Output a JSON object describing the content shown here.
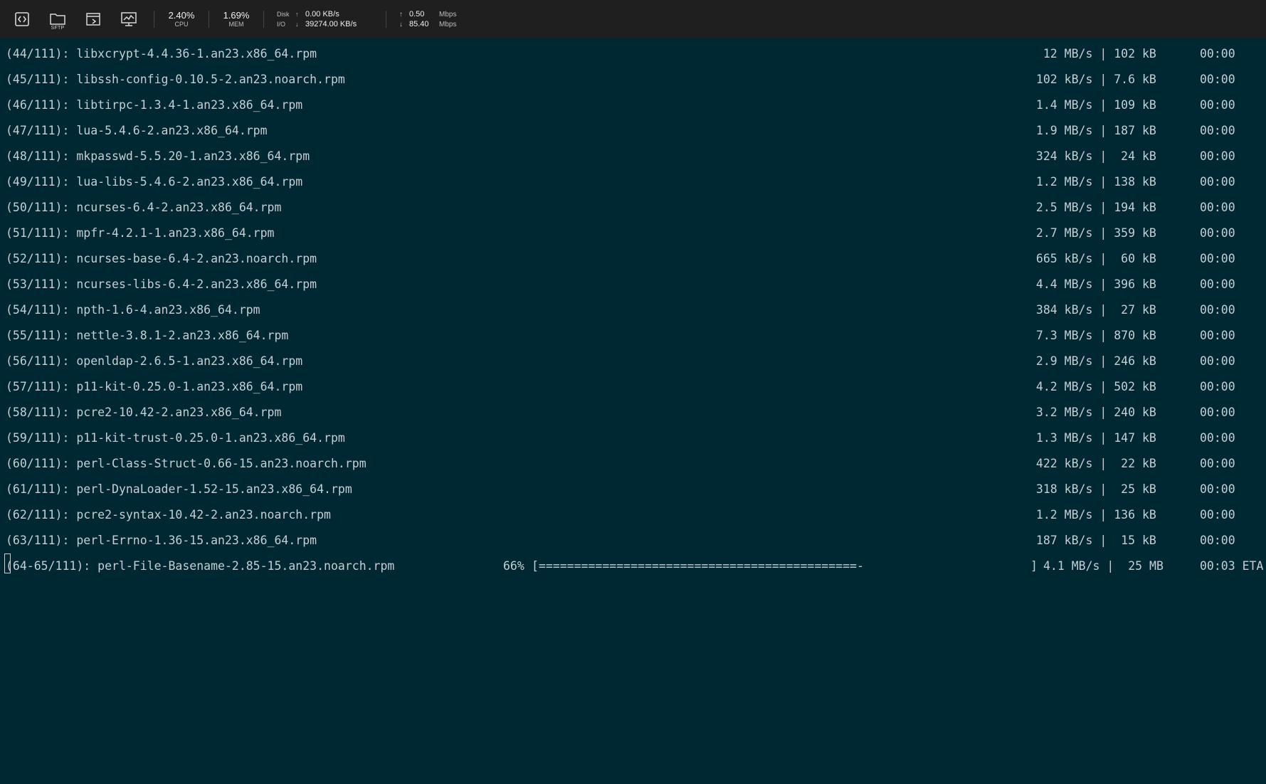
{
  "toolbar": {
    "buttons": [
      {
        "icon": "code-brackets-icon"
      },
      {
        "icon": "sftp-folder-icon",
        "sub": "SFTP"
      },
      {
        "icon": "window-arrow-icon"
      },
      {
        "icon": "monitor-chart-icon"
      }
    ],
    "cpu": {
      "value": "2.40%",
      "label": "CPU"
    },
    "mem": {
      "value": "1.69%",
      "label": "MEM"
    },
    "disk": {
      "label_top": "Disk",
      "label_bottom": "I/O",
      "up_arrow": "↑",
      "down_arrow": "↓",
      "read": "0.00 KB/s",
      "write": "39274.00 KB/s"
    },
    "net": {
      "up_arrow": "↑",
      "down_arrow": "↓",
      "up": "0.50",
      "down": "85.40",
      "unit_up": "Mbps",
      "unit_down": "Mbps"
    }
  },
  "terminal": {
    "lines": [
      {
        "name": "(44/111): libxcrypt-4.4.36-1.an23.x86_64.rpm",
        "stats": "  12 MB/s | 102 kB",
        "time": "00:00"
      },
      {
        "name": "(45/111): libssh-config-0.10.5-2.an23.noarch.rpm",
        "stats": " 102 kB/s | 7.6 kB",
        "time": "00:00"
      },
      {
        "name": "(46/111): libtirpc-1.3.4-1.an23.x86_64.rpm",
        "stats": " 1.4 MB/s | 109 kB",
        "time": "00:00"
      },
      {
        "name": "(47/111): lua-5.4.6-2.an23.x86_64.rpm",
        "stats": " 1.9 MB/s | 187 kB",
        "time": "00:00"
      },
      {
        "name": "(48/111): mkpasswd-5.5.20-1.an23.x86_64.rpm",
        "stats": " 324 kB/s |  24 kB",
        "time": "00:00"
      },
      {
        "name": "(49/111): lua-libs-5.4.6-2.an23.x86_64.rpm",
        "stats": " 1.2 MB/s | 138 kB",
        "time": "00:00"
      },
      {
        "name": "(50/111): ncurses-6.4-2.an23.x86_64.rpm",
        "stats": " 2.5 MB/s | 194 kB",
        "time": "00:00"
      },
      {
        "name": "(51/111): mpfr-4.2.1-1.an23.x86_64.rpm",
        "stats": " 2.7 MB/s | 359 kB",
        "time": "00:00"
      },
      {
        "name": "(52/111): ncurses-base-6.4-2.an23.noarch.rpm",
        "stats": " 665 kB/s |  60 kB",
        "time": "00:00"
      },
      {
        "name": "(53/111): ncurses-libs-6.4-2.an23.x86_64.rpm",
        "stats": " 4.4 MB/s | 396 kB",
        "time": "00:00"
      },
      {
        "name": "(54/111): npth-1.6-4.an23.x86_64.rpm",
        "stats": " 384 kB/s |  27 kB",
        "time": "00:00"
      },
      {
        "name": "(55/111): nettle-3.8.1-2.an23.x86_64.rpm",
        "stats": " 7.3 MB/s | 870 kB",
        "time": "00:00"
      },
      {
        "name": "(56/111): openldap-2.6.5-1.an23.x86_64.rpm",
        "stats": " 2.9 MB/s | 246 kB",
        "time": "00:00"
      },
      {
        "name": "(57/111): p11-kit-0.25.0-1.an23.x86_64.rpm",
        "stats": " 4.2 MB/s | 502 kB",
        "time": "00:00"
      },
      {
        "name": "(58/111): pcre2-10.42-2.an23.x86_64.rpm",
        "stats": " 3.2 MB/s | 240 kB",
        "time": "00:00"
      },
      {
        "name": "(59/111): p11-kit-trust-0.25.0-1.an23.x86_64.rpm",
        "stats": " 1.3 MB/s | 147 kB",
        "time": "00:00"
      },
      {
        "name": "(60/111): perl-Class-Struct-0.66-15.an23.noarch.rpm",
        "stats": " 422 kB/s |  22 kB",
        "time": "00:00"
      },
      {
        "name": "(61/111): perl-DynaLoader-1.52-15.an23.x86_64.rpm",
        "stats": " 318 kB/s |  25 kB",
        "time": "00:00"
      },
      {
        "name": "(62/111): pcre2-syntax-10.42-2.an23.noarch.rpm",
        "stats": " 1.2 MB/s | 136 kB",
        "time": "00:00"
      },
      {
        "name": "(63/111): perl-Errno-1.36-15.an23.x86_64.rpm",
        "stats": " 187 kB/s |  15 kB",
        "time": "00:00"
      }
    ],
    "progress_line": {
      "name": "(64-65/111): perl-File-Basename-2.85-15.an23.noarch.rpm",
      "percent": "66%",
      "bar": "[=============================================-",
      "bar_end": "]",
      "stats": "4.1 MB/s |  25 MB",
      "time": "00:03 ETA"
    }
  }
}
